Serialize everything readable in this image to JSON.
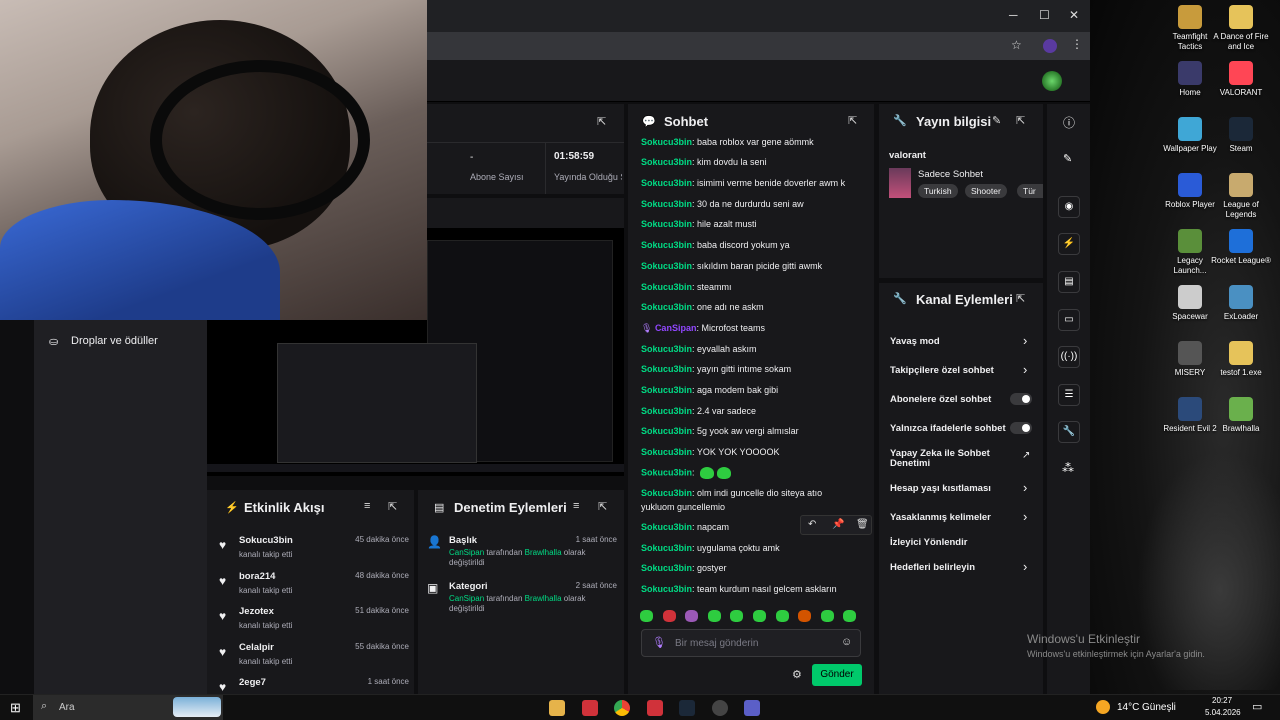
{
  "browser": {
    "window_controls": {
      "minimize": "─",
      "maximize": "☐",
      "close": "✕"
    }
  },
  "stats": {
    "abone_value": "-",
    "abone_label": "Abone Sayısı",
    "uptime_value": "01:58:59",
    "uptime_label": "Yayında Olduğu Süre"
  },
  "left_nav": {
    "droplar": "Droplar ve ödüller"
  },
  "chat": {
    "title": "Sohbet",
    "lines": [
      {
        "user": "Sokucu3bin",
        "text": "baba roblox var gene aömmk"
      },
      {
        "user": "Sokucu3bin",
        "text": "kim dovdu la seni"
      },
      {
        "user": "Sokucu3bin",
        "text": "isimimi verme benide doverler awm k"
      },
      {
        "user": "Sokucu3bin",
        "text": "30 da ne durdurdu seni aw"
      },
      {
        "user": "Sokucu3bin",
        "text": "hile azalt musti"
      },
      {
        "user": "Sokucu3bin",
        "text": "baba discord yokum ya"
      },
      {
        "user": "Sokucu3bin",
        "text": "sıkıldım baran picide gitti awmk"
      },
      {
        "user": "Sokucu3bin",
        "text": "steammı"
      },
      {
        "user": "Sokucu3bin",
        "text": "one adı ne askm"
      },
      {
        "user": "CanSipan",
        "text": "Microfost teams"
      },
      {
        "user": "Sokucu3bin",
        "text": "eyvallah askım"
      },
      {
        "user": "Sokucu3bin",
        "text": "yayın gitti intıme sokam"
      },
      {
        "user": "Sokucu3bin",
        "text": "aga modem bak gibi"
      },
      {
        "user": "Sokucu3bin",
        "text": "2.4 var sadece"
      },
      {
        "user": "Sokucu3bin",
        "text": "5g yook aw vergi almıslar"
      },
      {
        "user": "Sokucu3bin",
        "text": "YOK YOK YOOOOK"
      },
      {
        "user": "Sokucu3bin",
        "text": ""
      },
      {
        "user": "Sokucu3bin",
        "text": "olm indi guncelle dio siteya atıo"
      },
      {
        "user": "",
        "text": "yukluom guncellemio"
      },
      {
        "user": "Sokucu3bin",
        "text": "napcam"
      },
      {
        "user": "Sokucu3bin",
        "text": "uygulama çoktu amk"
      },
      {
        "user": "Sokucu3bin",
        "text": "gostyer"
      },
      {
        "user": "Sokucu3bin",
        "text": "team kurdum nasıl gelcem askların"
      }
    ],
    "placeholder": "Bir mesaj gönderin",
    "send": "Gönder"
  },
  "stream_info": {
    "title": "Yayın bilgisi",
    "game": "valorant",
    "category": "Sadece Sohbet",
    "tags": [
      "Turkish",
      "Shooter",
      "Tür"
    ]
  },
  "channel_actions": {
    "title": "Kanal Eylemleri",
    "items": [
      {
        "label": "Yavaş mod",
        "type": "chevron"
      },
      {
        "label": "Takipçilere özel sohbet",
        "type": "chevron"
      },
      {
        "label": "Abonelere özel sohbet",
        "type": "toggle"
      },
      {
        "label": "Yalnızca ifadelerle sohbet",
        "type": "toggle"
      },
      {
        "label": "Yapay Zeka ile Sohbet Denetimi",
        "type": "external"
      },
      {
        "label": "Hesap yaşı kısıtlaması",
        "type": "chevron"
      },
      {
        "label": "Yasaklanmış kelimeler",
        "type": "chevron"
      },
      {
        "label": "İzleyici Yönlendir",
        "type": "none"
      },
      {
        "label": "Hedefleri belirleyin",
        "type": "chevron"
      }
    ]
  },
  "activity": {
    "title": "Etkinlik Akışı",
    "items": [
      {
        "name": "Sokucu3bin",
        "sub": "kanalı takip etti",
        "time": "45 dakika önce"
      },
      {
        "name": "bora214",
        "sub": "kanalı takip etti",
        "time": "48 dakika önce"
      },
      {
        "name": "Jezotex",
        "sub": "kanalı takip etti",
        "time": "51 dakika önce"
      },
      {
        "name": "Celalpir",
        "sub": "kanalı takip etti",
        "time": "55 dakika önce"
      },
      {
        "name": "2ege7",
        "sub": "",
        "time": "1 saat önce"
      }
    ]
  },
  "moderation": {
    "title": "Denetim Eylemleri",
    "items": [
      {
        "title": "Başlık",
        "time": "1 saat önce",
        "actor": "CanSipan",
        "mid": " tarafından ",
        "target": "Brawlhalla",
        "end": " olarak değiştirildi"
      },
      {
        "title": "Kategori",
        "time": "2 saat önce",
        "actor": "CanSipan",
        "mid": " tarafından ",
        "target": "Brawlhalla",
        "end": " olarak değiştirildi"
      }
    ]
  },
  "desktop_icons": [
    {
      "label": "Teamfight Tactics",
      "color": "#c89b3c"
    },
    {
      "label": "A Dance of Fire and Ice",
      "color": "#e6c35a"
    },
    {
      "label": "Home",
      "color": "#3a3a6a"
    },
    {
      "label": "VALORANT",
      "color": "#ff4655"
    },
    {
      "label": "Wallpaper Play",
      "color": "#3fa7d6"
    },
    {
      "label": "Steam",
      "color": "#1b2838"
    },
    {
      "label": "Roblox Player",
      "color": "#2a5bd7"
    },
    {
      "label": "League of Legends",
      "color": "#c8aa6e"
    },
    {
      "label": "Legacy Launch...",
      "color": "#5a8f3a"
    },
    {
      "label": "Rocket League®",
      "color": "#1e6fd9"
    },
    {
      "label": "Spacewar",
      "color": "#cccccc"
    },
    {
      "label": "ExLoader",
      "color": "#4a90c2"
    },
    {
      "label": "MISERY",
      "color": "#555555"
    },
    {
      "label": "testof 1.exe",
      "color": "#e6c35a"
    },
    {
      "label": "Resident Evil 2",
      "color": "#2b4a7a"
    },
    {
      "label": "Brawlhalla",
      "color": "#6ab04c"
    }
  ],
  "watermark": {
    "line1": "Windows'u Etkinleştir",
    "line2": "Windows'u etkinleştirmek için Ayarlar'a gidin."
  },
  "taskbar": {
    "search": "Ara",
    "weather": "14°C",
    "weather_desc": "Güneşli",
    "time": "20:27",
    "date": "5.04.2026"
  }
}
